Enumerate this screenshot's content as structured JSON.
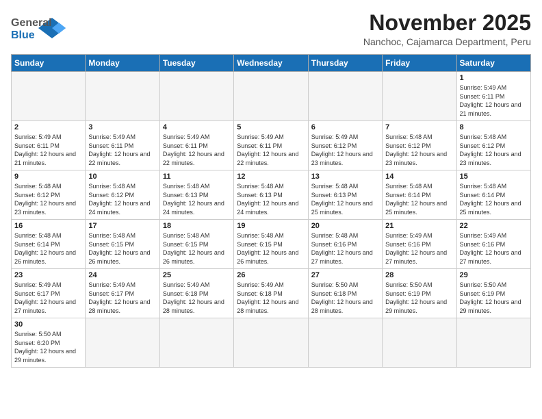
{
  "header": {
    "logo_general": "General",
    "logo_blue": "Blue",
    "month_title": "November 2025",
    "location": "Nanchoc, Cajamarca Department, Peru"
  },
  "weekdays": [
    "Sunday",
    "Monday",
    "Tuesday",
    "Wednesday",
    "Thursday",
    "Friday",
    "Saturday"
  ],
  "weeks": [
    [
      {
        "day": "",
        "empty": true
      },
      {
        "day": "",
        "empty": true
      },
      {
        "day": "",
        "empty": true
      },
      {
        "day": "",
        "empty": true
      },
      {
        "day": "",
        "empty": true
      },
      {
        "day": "",
        "empty": true
      },
      {
        "day": "1",
        "sunrise": "5:49 AM",
        "sunset": "6:11 PM",
        "daylight": "12 hours and 21 minutes."
      }
    ],
    [
      {
        "day": "2",
        "sunrise": "5:49 AM",
        "sunset": "6:11 PM",
        "daylight": "12 hours and 21 minutes."
      },
      {
        "day": "3",
        "sunrise": "5:49 AM",
        "sunset": "6:11 PM",
        "daylight": "12 hours and 22 minutes."
      },
      {
        "day": "4",
        "sunrise": "5:49 AM",
        "sunset": "6:11 PM",
        "daylight": "12 hours and 22 minutes."
      },
      {
        "day": "5",
        "sunrise": "5:49 AM",
        "sunset": "6:11 PM",
        "daylight": "12 hours and 22 minutes."
      },
      {
        "day": "6",
        "sunrise": "5:49 AM",
        "sunset": "6:12 PM",
        "daylight": "12 hours and 23 minutes."
      },
      {
        "day": "7",
        "sunrise": "5:48 AM",
        "sunset": "6:12 PM",
        "daylight": "12 hours and 23 minutes."
      },
      {
        "day": "8",
        "sunrise": "5:48 AM",
        "sunset": "6:12 PM",
        "daylight": "12 hours and 23 minutes."
      }
    ],
    [
      {
        "day": "9",
        "sunrise": "5:48 AM",
        "sunset": "6:12 PM",
        "daylight": "12 hours and 23 minutes."
      },
      {
        "day": "10",
        "sunrise": "5:48 AM",
        "sunset": "6:12 PM",
        "daylight": "12 hours and 24 minutes."
      },
      {
        "day": "11",
        "sunrise": "5:48 AM",
        "sunset": "6:13 PM",
        "daylight": "12 hours and 24 minutes."
      },
      {
        "day": "12",
        "sunrise": "5:48 AM",
        "sunset": "6:13 PM",
        "daylight": "12 hours and 24 minutes."
      },
      {
        "day": "13",
        "sunrise": "5:48 AM",
        "sunset": "6:13 PM",
        "daylight": "12 hours and 25 minutes."
      },
      {
        "day": "14",
        "sunrise": "5:48 AM",
        "sunset": "6:14 PM",
        "daylight": "12 hours and 25 minutes."
      },
      {
        "day": "15",
        "sunrise": "5:48 AM",
        "sunset": "6:14 PM",
        "daylight": "12 hours and 25 minutes."
      }
    ],
    [
      {
        "day": "16",
        "sunrise": "5:48 AM",
        "sunset": "6:14 PM",
        "daylight": "12 hours and 26 minutes."
      },
      {
        "day": "17",
        "sunrise": "5:48 AM",
        "sunset": "6:15 PM",
        "daylight": "12 hours and 26 minutes."
      },
      {
        "day": "18",
        "sunrise": "5:48 AM",
        "sunset": "6:15 PM",
        "daylight": "12 hours and 26 minutes."
      },
      {
        "day": "19",
        "sunrise": "5:48 AM",
        "sunset": "6:15 PM",
        "daylight": "12 hours and 26 minutes."
      },
      {
        "day": "20",
        "sunrise": "5:48 AM",
        "sunset": "6:16 PM",
        "daylight": "12 hours and 27 minutes."
      },
      {
        "day": "21",
        "sunrise": "5:49 AM",
        "sunset": "6:16 PM",
        "daylight": "12 hours and 27 minutes."
      },
      {
        "day": "22",
        "sunrise": "5:49 AM",
        "sunset": "6:16 PM",
        "daylight": "12 hours and 27 minutes."
      }
    ],
    [
      {
        "day": "23",
        "sunrise": "5:49 AM",
        "sunset": "6:17 PM",
        "daylight": "12 hours and 27 minutes."
      },
      {
        "day": "24",
        "sunrise": "5:49 AM",
        "sunset": "6:17 PM",
        "daylight": "12 hours and 28 minutes."
      },
      {
        "day": "25",
        "sunrise": "5:49 AM",
        "sunset": "6:18 PM",
        "daylight": "12 hours and 28 minutes."
      },
      {
        "day": "26",
        "sunrise": "5:49 AM",
        "sunset": "6:18 PM",
        "daylight": "12 hours and 28 minutes."
      },
      {
        "day": "27",
        "sunrise": "5:50 AM",
        "sunset": "6:18 PM",
        "daylight": "12 hours and 28 minutes."
      },
      {
        "day": "28",
        "sunrise": "5:50 AM",
        "sunset": "6:19 PM",
        "daylight": "12 hours and 29 minutes."
      },
      {
        "day": "29",
        "sunrise": "5:50 AM",
        "sunset": "6:19 PM",
        "daylight": "12 hours and 29 minutes."
      }
    ],
    [
      {
        "day": "30",
        "sunrise": "5:50 AM",
        "sunset": "6:20 PM",
        "daylight": "12 hours and 29 minutes."
      },
      {
        "day": "",
        "empty": true
      },
      {
        "day": "",
        "empty": true
      },
      {
        "day": "",
        "empty": true
      },
      {
        "day": "",
        "empty": true
      },
      {
        "day": "",
        "empty": true
      },
      {
        "day": "",
        "empty": true
      }
    ]
  ]
}
